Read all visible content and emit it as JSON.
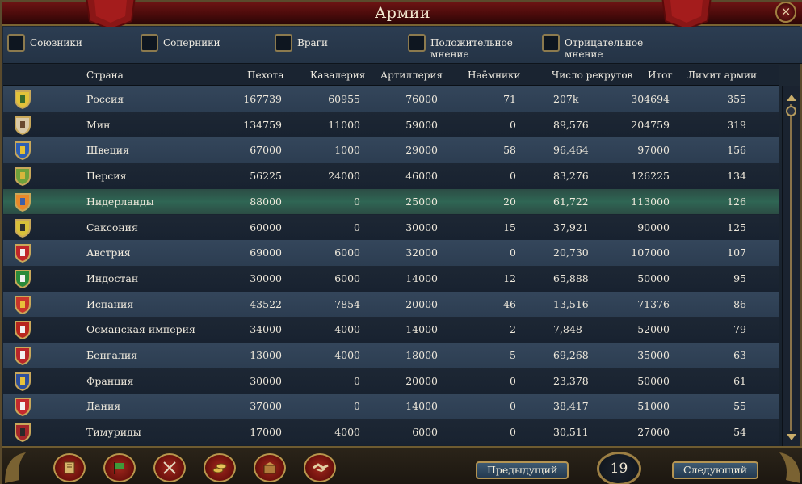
{
  "window": {
    "title": "Армии",
    "close_glyph": "×"
  },
  "filters": [
    {
      "label": "Союзники"
    },
    {
      "label": "Соперники"
    },
    {
      "label": "Враги"
    },
    {
      "label": "Положительное мнение"
    },
    {
      "label": "Отрицательное мнение"
    }
  ],
  "columns": {
    "country": "Страна",
    "infantry": "Пехота",
    "cavalry": "Кавалерия",
    "artillery": "Артиллерия",
    "mercenaries": "Наёмники",
    "manpower": "Число рекрутов",
    "total": "Итог",
    "force_limit": "Лимит армии"
  },
  "rows": [
    {
      "country": "Россия",
      "infantry": "167739",
      "cavalry": "60955",
      "artillery": "76000",
      "mercenaries": "71",
      "manpower": "207k",
      "total": "304694",
      "force_limit": "355",
      "flag": "russia-flag-icon",
      "colors": [
        "#e3c23a",
        "#3a6b2a"
      ]
    },
    {
      "country": "Мин",
      "infantry": "134759",
      "cavalry": "11000",
      "artillery": "59000",
      "mercenaries": "0",
      "manpower": "89,576",
      "total": "204759",
      "force_limit": "319",
      "flag": "ming-flag-icon",
      "colors": [
        "#d9c9a8",
        "#6a4a2e"
      ]
    },
    {
      "country": "Швеция",
      "infantry": "67000",
      "cavalry": "1000",
      "artillery": "29000",
      "mercenaries": "58",
      "manpower": "96,464",
      "total": "97000",
      "force_limit": "156",
      "flag": "sweden-flag-icon",
      "colors": [
        "#2f5fb3",
        "#e8c234"
      ]
    },
    {
      "country": "Персия",
      "infantry": "56225",
      "cavalry": "24000",
      "artillery": "46000",
      "mercenaries": "0",
      "manpower": "83,276",
      "total": "126225",
      "force_limit": "134",
      "flag": "persia-flag-icon",
      "colors": [
        "#6ea13c",
        "#d8b63c"
      ]
    },
    {
      "country": "Нидерланды",
      "infantry": "88000",
      "cavalry": "0",
      "artillery": "25000",
      "mercenaries": "20",
      "manpower": "61,722",
      "total": "113000",
      "force_limit": "126",
      "flag": "netherlands-flag-icon",
      "colors": [
        "#e8892a",
        "#3c5fa8"
      ]
    },
    {
      "country": "Саксония",
      "infantry": "60000",
      "cavalry": "0",
      "artillery": "30000",
      "mercenaries": "15",
      "manpower": "37,921",
      "total": "90000",
      "force_limit": "125",
      "flag": "saxony-flag-icon",
      "colors": [
        "#d8c03a",
        "#2f2f2f"
      ]
    },
    {
      "country": "Австрия",
      "infantry": "69000",
      "cavalry": "6000",
      "artillery": "32000",
      "mercenaries": "0",
      "manpower": "20,730",
      "total": "107000",
      "force_limit": "107",
      "flag": "austria-flag-icon",
      "colors": [
        "#c0262a",
        "#f2f2f2"
      ]
    },
    {
      "country": "Индостан",
      "infantry": "30000",
      "cavalry": "6000",
      "artillery": "14000",
      "mercenaries": "12",
      "manpower": "65,888",
      "total": "50000",
      "force_limit": "95",
      "flag": "hindustan-flag-icon",
      "colors": [
        "#2a8a3a",
        "#f2f2f2"
      ]
    },
    {
      "country": "Испания",
      "infantry": "43522",
      "cavalry": "7854",
      "artillery": "20000",
      "mercenaries": "46",
      "manpower": "13,516",
      "total": "71376",
      "force_limit": "86",
      "flag": "spain-flag-icon",
      "colors": [
        "#c8362a",
        "#e8c23a"
      ]
    },
    {
      "country": "Османская империя",
      "infantry": "34000",
      "cavalry": "4000",
      "artillery": "14000",
      "mercenaries": "2",
      "manpower": "7,848",
      "total": "52000",
      "force_limit": "79",
      "flag": "ottoman-flag-icon",
      "colors": [
        "#b8261e",
        "#f2f2f2"
      ]
    },
    {
      "country": "Бенгалия",
      "infantry": "13000",
      "cavalry": "4000",
      "artillery": "18000",
      "mercenaries": "5",
      "manpower": "69,268",
      "total": "35000",
      "force_limit": "63",
      "flag": "bengal-flag-icon",
      "colors": [
        "#b8262a",
        "#f2f2f2"
      ]
    },
    {
      "country": "Франция",
      "infantry": "30000",
      "cavalry": "0",
      "artillery": "20000",
      "mercenaries": "0",
      "manpower": "23,378",
      "total": "50000",
      "force_limit": "61",
      "flag": "france-flag-icon",
      "colors": [
        "#2e4f9c",
        "#e8c23a"
      ]
    },
    {
      "country": "Дания",
      "infantry": "37000",
      "cavalry": "0",
      "artillery": "14000",
      "mercenaries": "0",
      "manpower": "38,417",
      "total": "51000",
      "force_limit": "55",
      "flag": "denmark-flag-icon",
      "colors": [
        "#c42a2e",
        "#f2f2f2"
      ]
    },
    {
      "country": "Тимуриды",
      "infantry": "17000",
      "cavalry": "4000",
      "artillery": "6000",
      "mercenaries": "0",
      "manpower": "30,511",
      "total": "27000",
      "force_limit": "54",
      "flag": "timurids-flag-icon",
      "colors": [
        "#a3262a",
        "#2a2a2a"
      ]
    }
  ],
  "highlighted_row": 4,
  "pagination": {
    "prev_label": "Предыдущий",
    "next_label": "Следующий",
    "page": "19"
  },
  "toolbar": [
    "ledger-book-icon",
    "flag-icon",
    "crossed-swords-icon",
    "coins-icon",
    "trade-goods-icon",
    "handshake-icon"
  ]
}
